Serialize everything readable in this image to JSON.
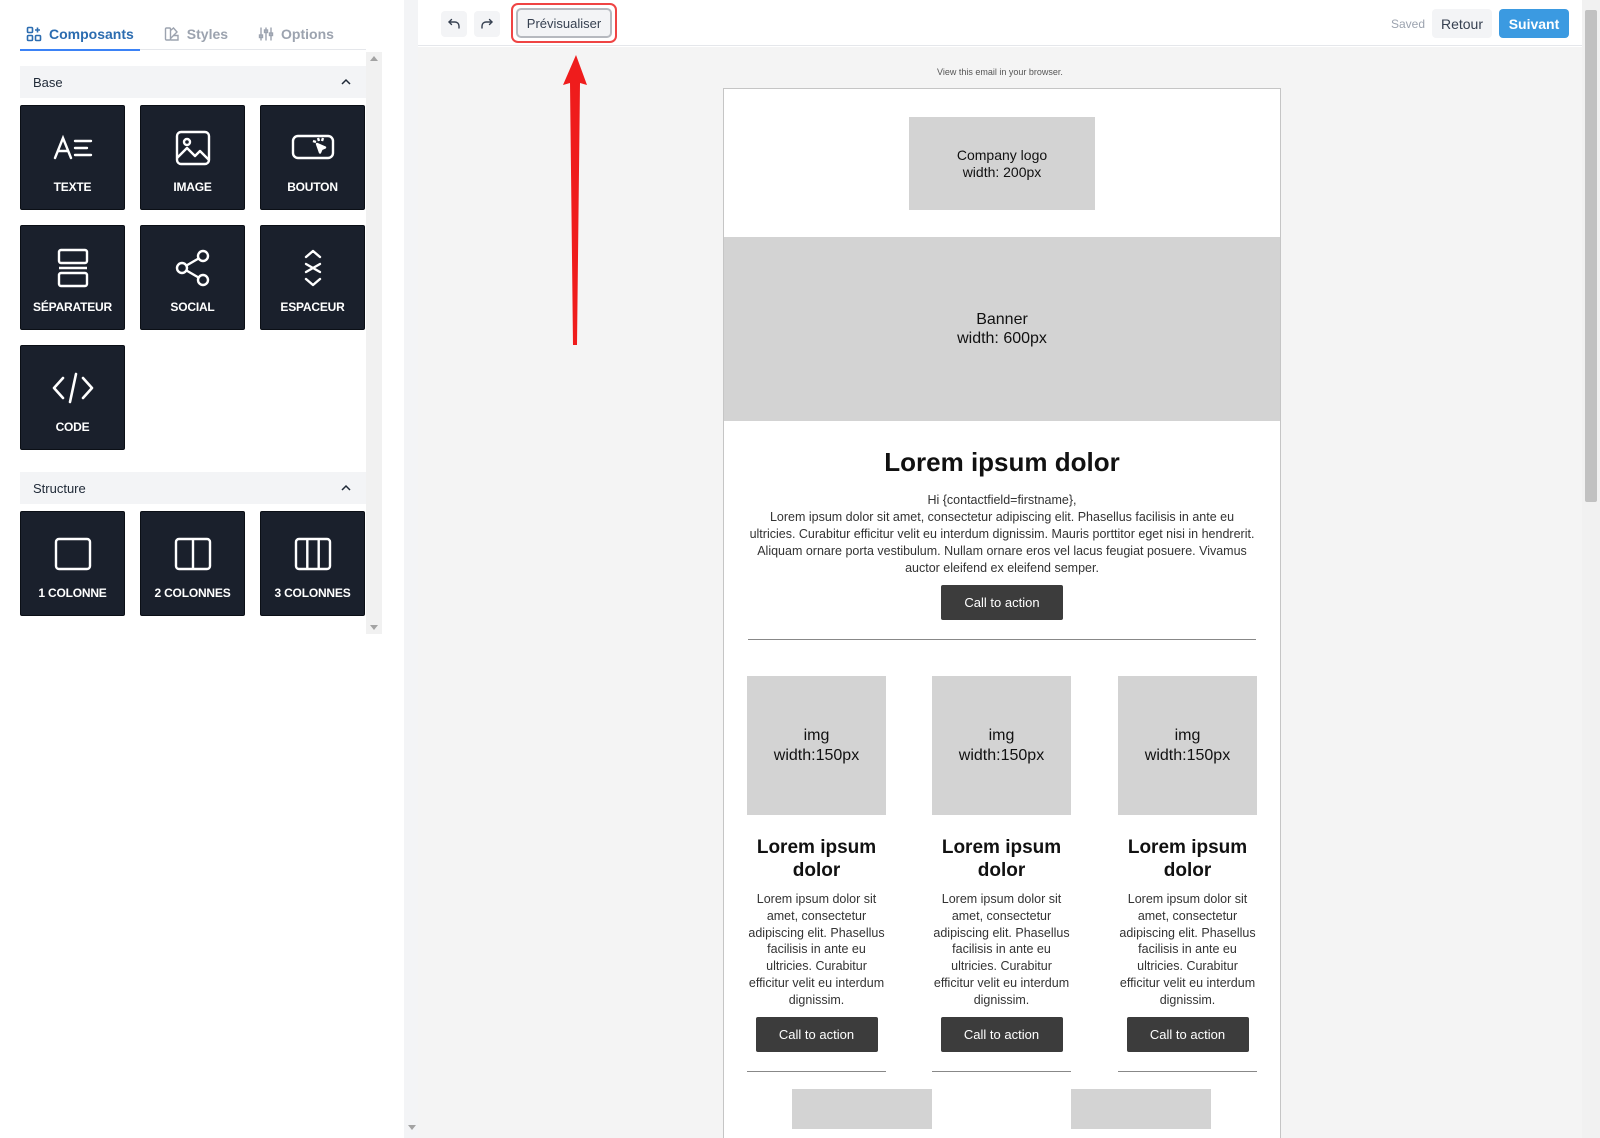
{
  "tabs": {
    "composants": "Composants",
    "styles": "Styles",
    "options": "Options"
  },
  "sections": {
    "base": "Base",
    "structure": "Structure"
  },
  "base_items": {
    "texte": "TEXTE",
    "image": "IMAGE",
    "bouton": "BOUTON",
    "separateur": "SÉPARATEUR",
    "social": "SOCIAL",
    "espaceur": "ESPACEUR",
    "code": "CODE"
  },
  "structure_items": {
    "col1": "1 COLONNE",
    "col2": "2 COLONNES",
    "col3": "3 COLONNES"
  },
  "toolbar": {
    "preview": "Prévisualiser",
    "saved": "Saved",
    "retour": "Retour",
    "suivant": "Suivant"
  },
  "email": {
    "browser_link": "View this email in your browser.",
    "logo_line1": "Company logo",
    "logo_line2": "width: 200px",
    "banner_line1": "Banner",
    "banner_line2": "width: 600px",
    "title": "Lorem ipsum dolor",
    "greeting": "Hi {contactfield=firstname},",
    "body": "Lorem ipsum dolor sit amet, consectetur adipiscing elit. Phasellus facilisis in ante eu ultricies. Curabitur efficitur velit eu interdum dignissim. Mauris porttitor eget nisi in hendrerit. Aliquam ornare porta vestibulum. Nullam ornare eros vel lacus feugiat posuere. Vivamus auctor eleifend ex eleifend semper.",
    "cta": "Call to action",
    "columns": [
      {
        "img_line1": "img",
        "img_line2": "width:150px",
        "title": "Lorem ipsum dolor",
        "text": "Lorem ipsum dolor sit amet, consectetur adipiscing elit. Phasellus facilisis in ante eu ultricies. Curabitur efficitur velit eu interdum dignissim.",
        "cta": "Call to action"
      },
      {
        "img_line1": "img",
        "img_line2": "width:150px",
        "title": "Lorem ipsum dolor",
        "text": "Lorem ipsum dolor sit amet, consectetur adipiscing elit. Phasellus facilisis in ante eu ultricies. Curabitur efficitur velit eu interdum dignissim.",
        "cta": "Call to action"
      },
      {
        "img_line1": "img",
        "img_line2": "width:150px",
        "title": "Lorem ipsum dolor",
        "text": "Lorem ipsum dolor sit amet, consectetur adipiscing elit. Phasellus facilisis in ante eu ultricies. Curabitur efficitur velit eu interdum dignissim.",
        "cta": "Call to action"
      }
    ]
  },
  "colors": {
    "accent_tab": "#2b6cb0",
    "primary_button": "#3b9ae1",
    "tile_bg": "#1a202c",
    "annotation": "#ef4444"
  }
}
